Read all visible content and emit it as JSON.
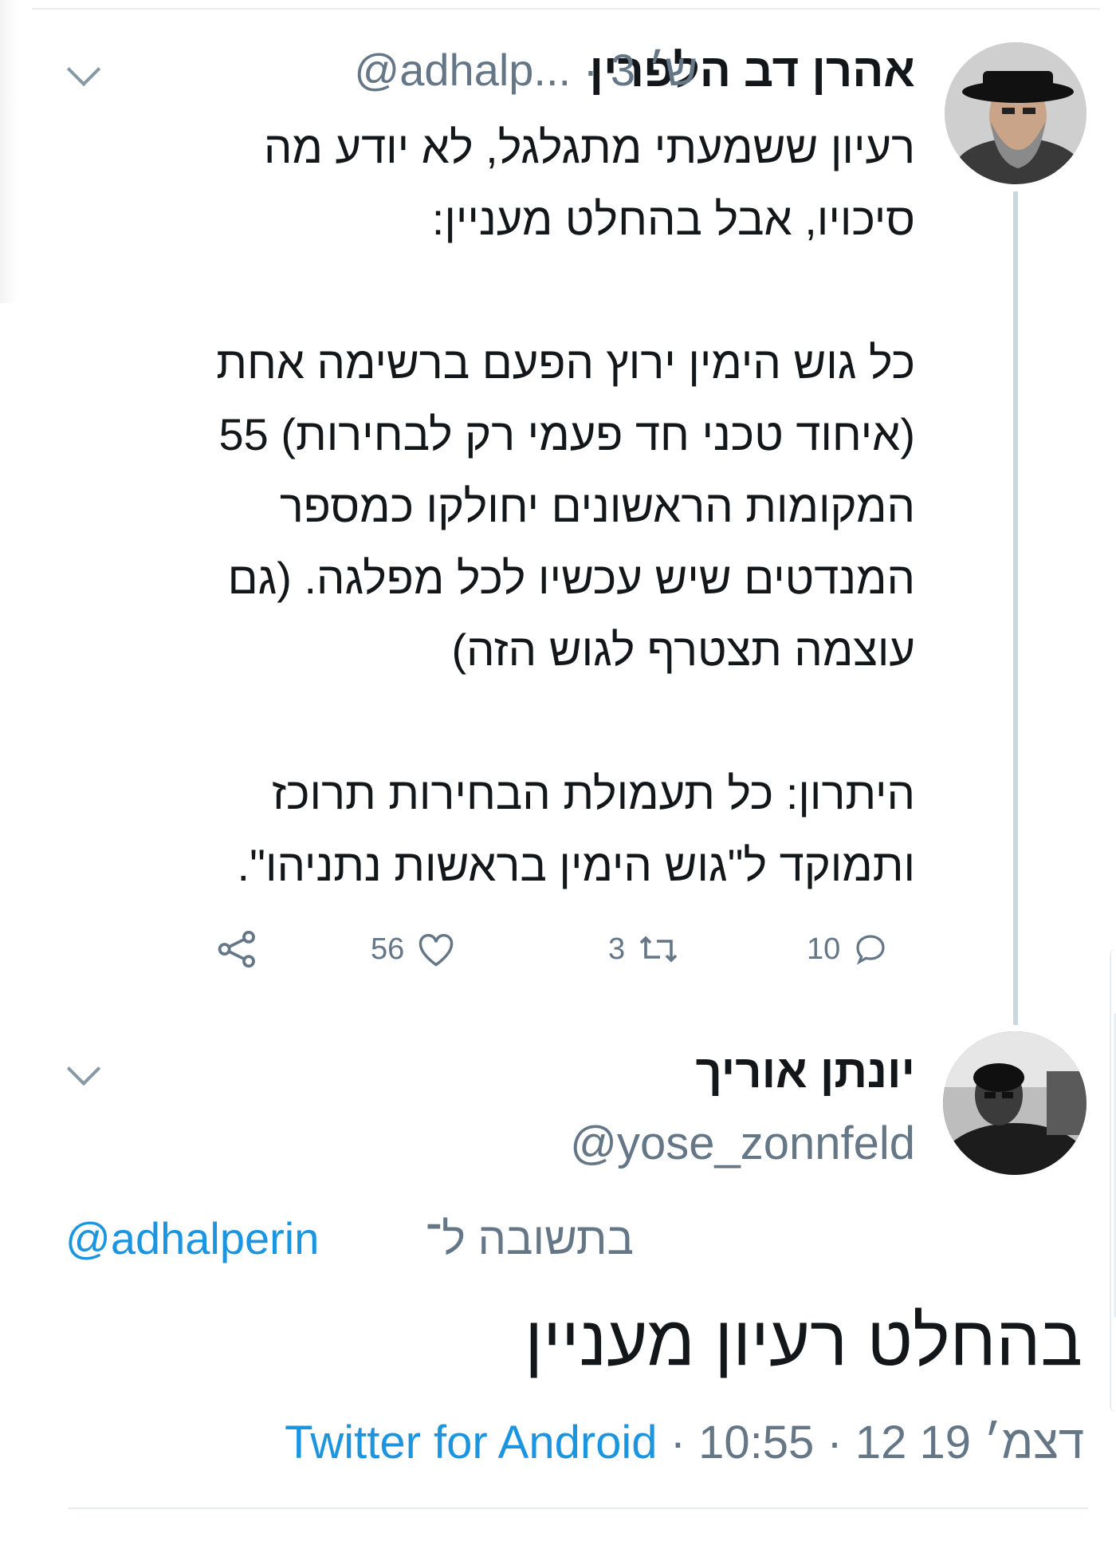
{
  "tweet": {
    "author_name": "אהרן דב הלפרין",
    "handle_line": "@adhalp... · 3 ש׳",
    "text": "רעיון ששמעתי מתגלגל, לא יודע מה\nסיכויו, אבל בהחלט מעניין:\n\nכל גוש הימין ירוץ הפעם ברשימה אחת\n(איחוד טכני חד פעמי רק לבחירות) 55\nהמקומות הראשונים יחולקו כמספר\nהמנדטים שיש עכשיו לכל מפלגה. (גם\nעוצמה תצטרף לגוש הזה)\n\nהיתרון: כל תעמולת הבחירות תרוכז\nותמוקד ל\"גוש הימין בראשות נתניהו\".",
    "replies": "10",
    "retweets": "3",
    "likes": "56"
  },
  "reply": {
    "author_name": "יונתן אוריך",
    "handle": "@yose_zonnfeld",
    "replying_label": "בתשובה ל־",
    "replying_handle": "@adhalperin",
    "text": "בהחלט רעיון מעניין",
    "time_date": "10:55 · 12 דצמ׳ 19",
    "source": "Twitter for Android"
  },
  "colors": {
    "text": "#14171a",
    "secondary": "#657786",
    "link": "#1b95e0",
    "divider": "#e6ecf0",
    "thread_line": "#ccd6dd"
  },
  "icons": [
    "avatar",
    "chevron-down-icon",
    "reply-icon",
    "retweet-icon",
    "like-icon",
    "share-icon"
  ]
}
